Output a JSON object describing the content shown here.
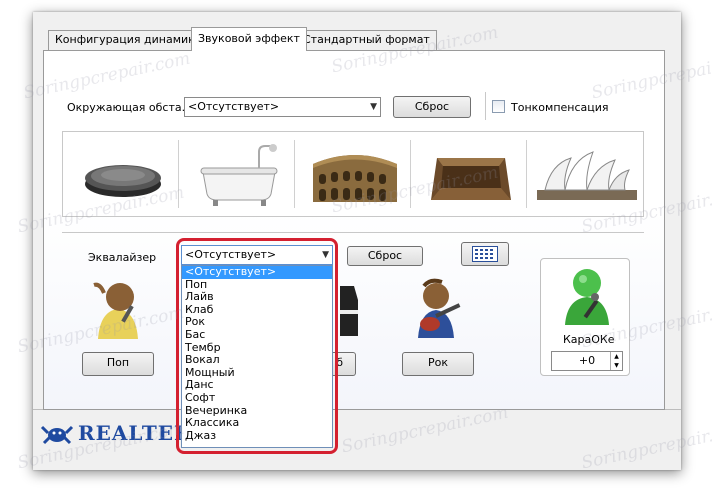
{
  "tabs": [
    {
      "label": "Конфигурация динамиков"
    },
    {
      "label": "Звуковой эффект"
    },
    {
      "label": "Стандартный формат"
    }
  ],
  "environment": {
    "label": "Окружающая обста...",
    "selected": "<Отсутствует>",
    "reset_label": "Сброс",
    "loudness_label": "Тонкомпенсация",
    "loudness_checked": false,
    "presets": [
      {
        "icon": "stone-disc-icon"
      },
      {
        "icon": "bathtub-icon"
      },
      {
        "icon": "colosseum-icon"
      },
      {
        "icon": "stone-room-icon"
      },
      {
        "icon": "opera-house-icon"
      }
    ]
  },
  "equalizer": {
    "label": "Эквалайзер",
    "selected": "<Отсутствует>",
    "reset_label": "Сброс",
    "options": [
      "<Отсутствует>",
      "Поп",
      "Лайв",
      "Клаб",
      "Рок",
      "Бас",
      "Тембр",
      "Вокал",
      "Мощный",
      "Данс",
      "Софт",
      "Вечеринка",
      "Классика",
      "Джаз"
    ],
    "highlighted_index": 0,
    "preset_buttons": [
      {
        "label": "Поп"
      },
      {
        "label": "б"
      },
      {
        "label": "Рок"
      }
    ]
  },
  "karaoke": {
    "label": "КараОКе",
    "value": "+0"
  },
  "brand": {
    "name": "REALTEK"
  },
  "watermark_text": "Soringpcrepair.com",
  "colors": {
    "selection": "#3399ff",
    "highlight_frame": "#d42030",
    "karaoke_green": "#3aa63a"
  }
}
